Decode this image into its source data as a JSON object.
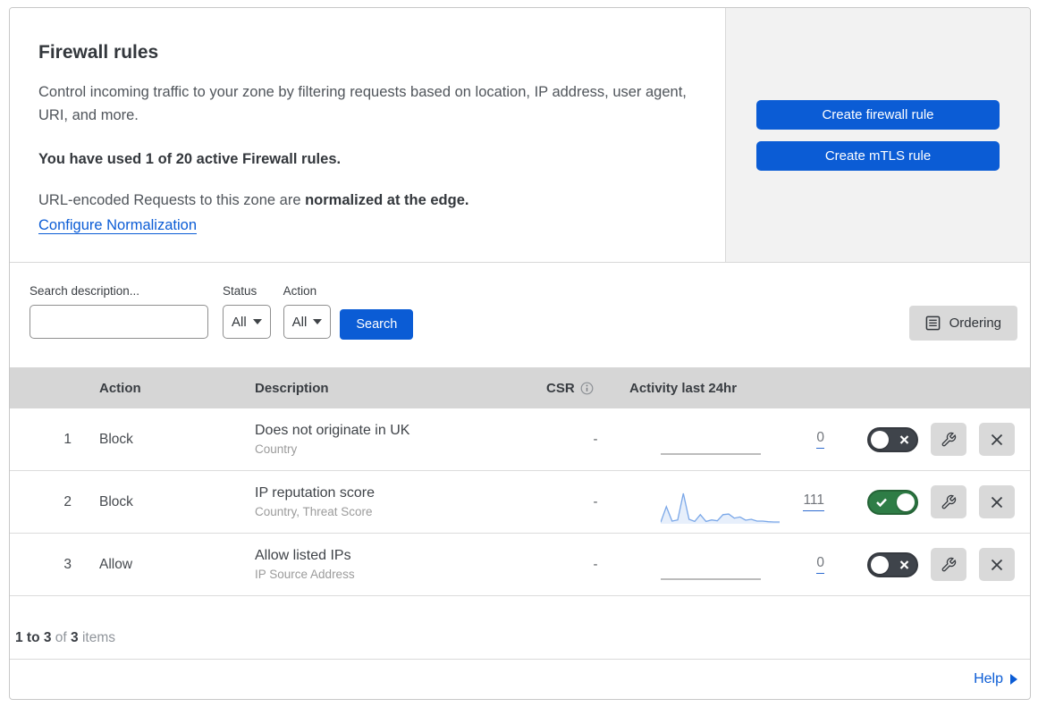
{
  "header": {
    "title": "Firewall rules",
    "description": "Control incoming traffic to your zone by filtering requests based on location, IP address, user agent, URI, and more.",
    "usage": "You have used 1 of 20 active Firewall rules.",
    "normalization_prefix": "URL-encoded Requests to this zone are ",
    "normalization_bold": "normalized at the edge.",
    "normalization_link": "Configure Normalization"
  },
  "actions_panel": {
    "create_firewall_rule": "Create firewall rule",
    "create_mtls_rule": "Create mTLS rule"
  },
  "filters": {
    "search_label": "Search description...",
    "search_value": "",
    "status_label": "Status",
    "status_value": "All",
    "action_label": "Action",
    "action_value": "All",
    "search_button": "Search",
    "ordering_button": "Ordering"
  },
  "table": {
    "headers": {
      "action": "Action",
      "description": "Description",
      "csr": "CSR",
      "activity": "Activity last 24hr"
    },
    "rows": [
      {
        "index": "1",
        "action": "Block",
        "description": "Does not originate in UK",
        "fields": "Country",
        "csr": "-",
        "activity_count": "0",
        "enabled": false
      },
      {
        "index": "2",
        "action": "Block",
        "description": "IP reputation score",
        "fields": "Country, Threat Score",
        "csr": "-",
        "activity_count": "111",
        "enabled": true
      },
      {
        "index": "3",
        "action": "Allow",
        "description": "Allow listed IPs",
        "fields": "IP Source Address",
        "csr": "-",
        "activity_count": "0",
        "enabled": false
      }
    ]
  },
  "chart_data": [
    {
      "type": "line",
      "label": "Rule 1 activity last 24hr sparkline",
      "flat_zero": true,
      "total": 0
    },
    {
      "type": "line",
      "label": "Rule 2 activity last 24hr sparkline",
      "ylim": [
        0,
        100
      ],
      "total": 111,
      "values": [
        2,
        55,
        6,
        10,
        100,
        12,
        5,
        28,
        5,
        10,
        7,
        28,
        30,
        16,
        20,
        9,
        12,
        6,
        6,
        4,
        3,
        3
      ]
    },
    {
      "type": "line",
      "label": "Rule 3 activity last 24hr sparkline",
      "flat_zero": true,
      "total": 0
    }
  ],
  "footer": {
    "range": "1 to 3",
    "of_label": "of",
    "total": "3",
    "items_label": "items",
    "help_label": "Help"
  },
  "icons": {
    "search": "magnifier",
    "ordering": "list-page",
    "csr_info": "circled-i",
    "toggle_on": "check",
    "toggle_off": "x",
    "edit": "wrench",
    "delete": "x",
    "help": "right-triangle",
    "dropdown": "down-triangle"
  },
  "colors": {
    "accent_blue": "#0b5cd5",
    "toggle_on_green": "#2e7d46",
    "toggle_off_charcoal": "#3f444b",
    "sparkline_blue": "#7aa7e8",
    "side_panel_gray": "#f2f2f2",
    "table_header_gray": "#d6d6d6",
    "control_button_gray": "#d9d9d9"
  }
}
